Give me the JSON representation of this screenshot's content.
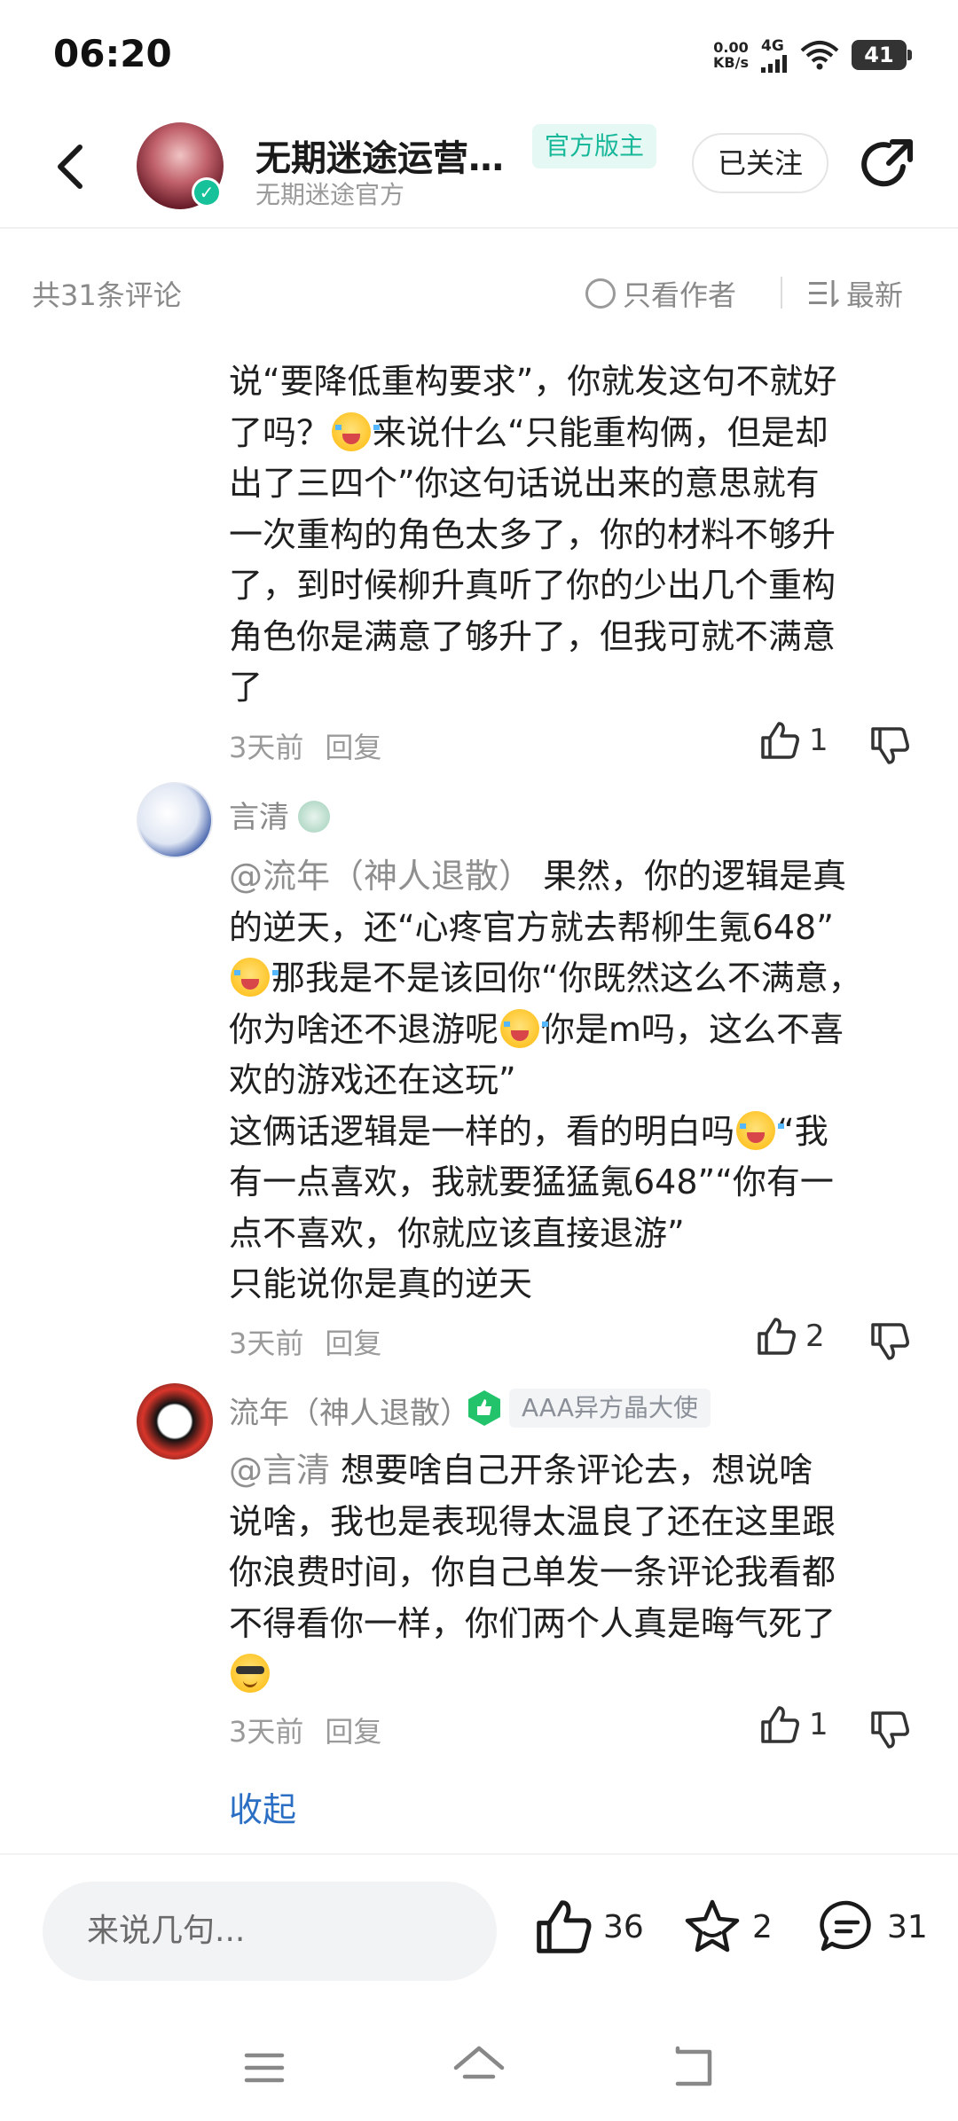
{
  "status_bar": {
    "time": "06:20",
    "net_speed_value": "0.00",
    "net_speed_unit": "KB/s",
    "network": "4G",
    "battery": "41"
  },
  "header": {
    "title": "无期迷途运营…",
    "subtitle": "无期迷途官方",
    "tag": "官方版主",
    "follow_label": "已关注"
  },
  "comments_bar": {
    "count_label": "共31条评论",
    "author_only_label": "只看作者",
    "sort_label": "最新"
  },
  "comments": [
    {
      "text_lines": [
        "说“要降低重构要求”，你就发这句不就好",
        "了吗？",
        "来说什么“只能重构俩，但是却",
        "出了三四个”你这句话说出来的意思就有",
        "一次重构的角色太多了，你的材料不够升",
        "了，到时候柳升真听了你的少出几个重构",
        "角色你是满意了够升了，但我可就不满意",
        "了"
      ],
      "time": "3天前",
      "reply_label": "回复",
      "likes": "1"
    },
    {
      "user": "言清",
      "mention": "@流年（神人退散）",
      "text_lines": [
        "果然，你的逻辑是真",
        "的逆天，还“心疼官方就去帮柳生氪648”",
        "那我是不是该回你“你既然这么不满意，",
        "你为啥还不退游呢",
        "你是m吗，这么不喜",
        "欢的游戏还在这玩”",
        "这俩话逻辑是一样的，看的明白吗",
        "“我",
        "有一点喜欢，我就要猛猛氪648”“你有一",
        "点不喜欢，你就应该直接退游”",
        "只能说你是真的逆天"
      ],
      "time": "3天前",
      "reply_label": "回复",
      "likes": "2"
    },
    {
      "user": "流年（神人退散）",
      "medal": "AAA异方晶大使",
      "mention": "@言清",
      "text_lines": [
        "想要啥自己开条评论去，想说啥",
        "说啥，我也是表现得太温良了还在这里跟",
        "你浪费时间，你自己单发一条评论我看都",
        "不得看你一样，你们两个人真是晦气死了"
      ],
      "time": "3天前",
      "reply_label": "回复",
      "likes": "1"
    }
  ],
  "collapse_label": "收起",
  "bottom_bar": {
    "input_placeholder": "来说几句...",
    "like_count": "36",
    "star_count": "2",
    "comment_count": "31"
  },
  "colors": {
    "accent_green": "#17b89a",
    "link_blue": "#2a6fc4",
    "muted_gray": "#9a9a9a"
  },
  "icons": [
    "back-arrow-icon",
    "verified-icon",
    "share-icon",
    "radio-circle-icon",
    "sort-icon",
    "thumbs-up-icon",
    "thumbs-down-icon",
    "star-icon",
    "comment-bubble-icon",
    "menu-icon",
    "home-icon",
    "back-nav-icon"
  ]
}
